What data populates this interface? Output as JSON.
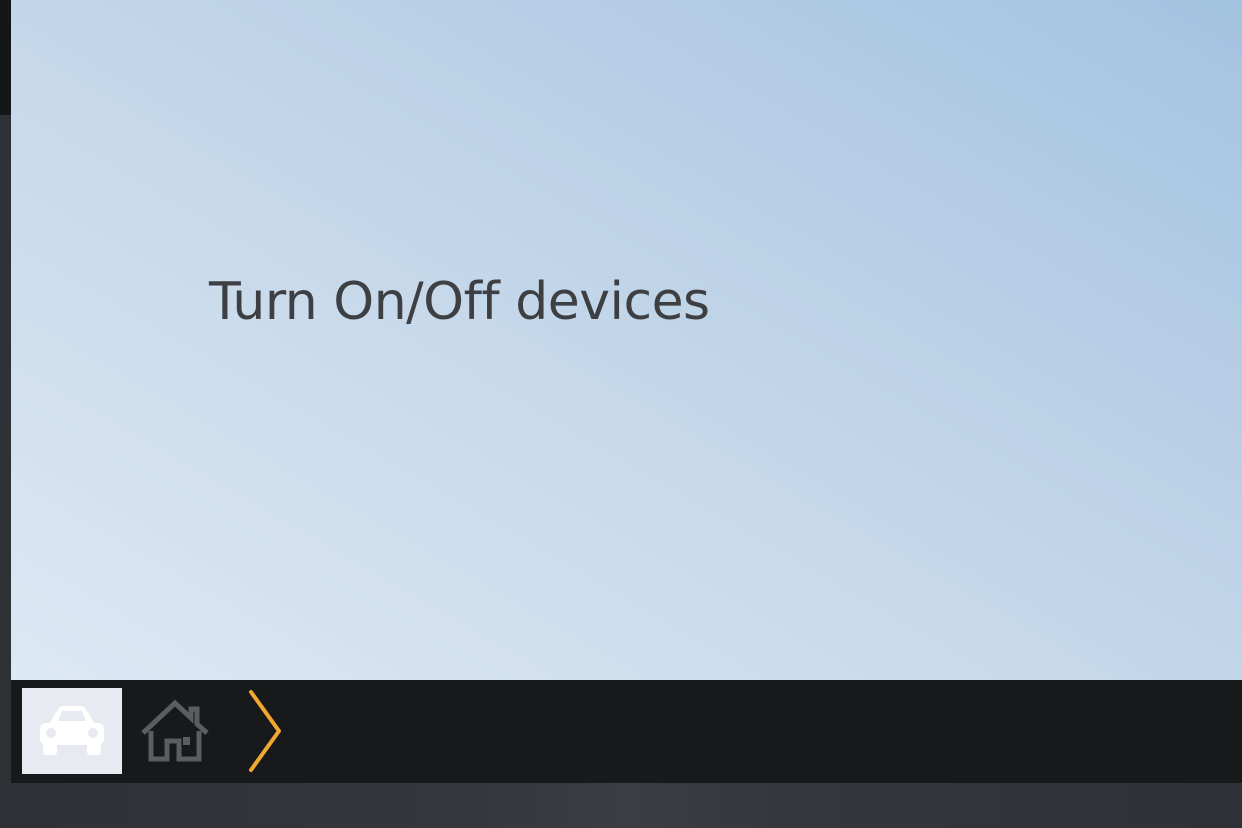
{
  "slide": {
    "title": "Turn On/Off devices"
  },
  "bottom_bar": {
    "items": [
      {
        "icon": "car-icon",
        "selected": true
      },
      {
        "icon": "home-icon",
        "selected": false
      },
      {
        "icon": "chevron-right-icon",
        "selected": false
      }
    ]
  },
  "colors": {
    "bar_background": "#17191b",
    "selected_tile": "#e7eaf0",
    "chevron_accent": "#f0a830",
    "title_text": "#3d3f42"
  }
}
